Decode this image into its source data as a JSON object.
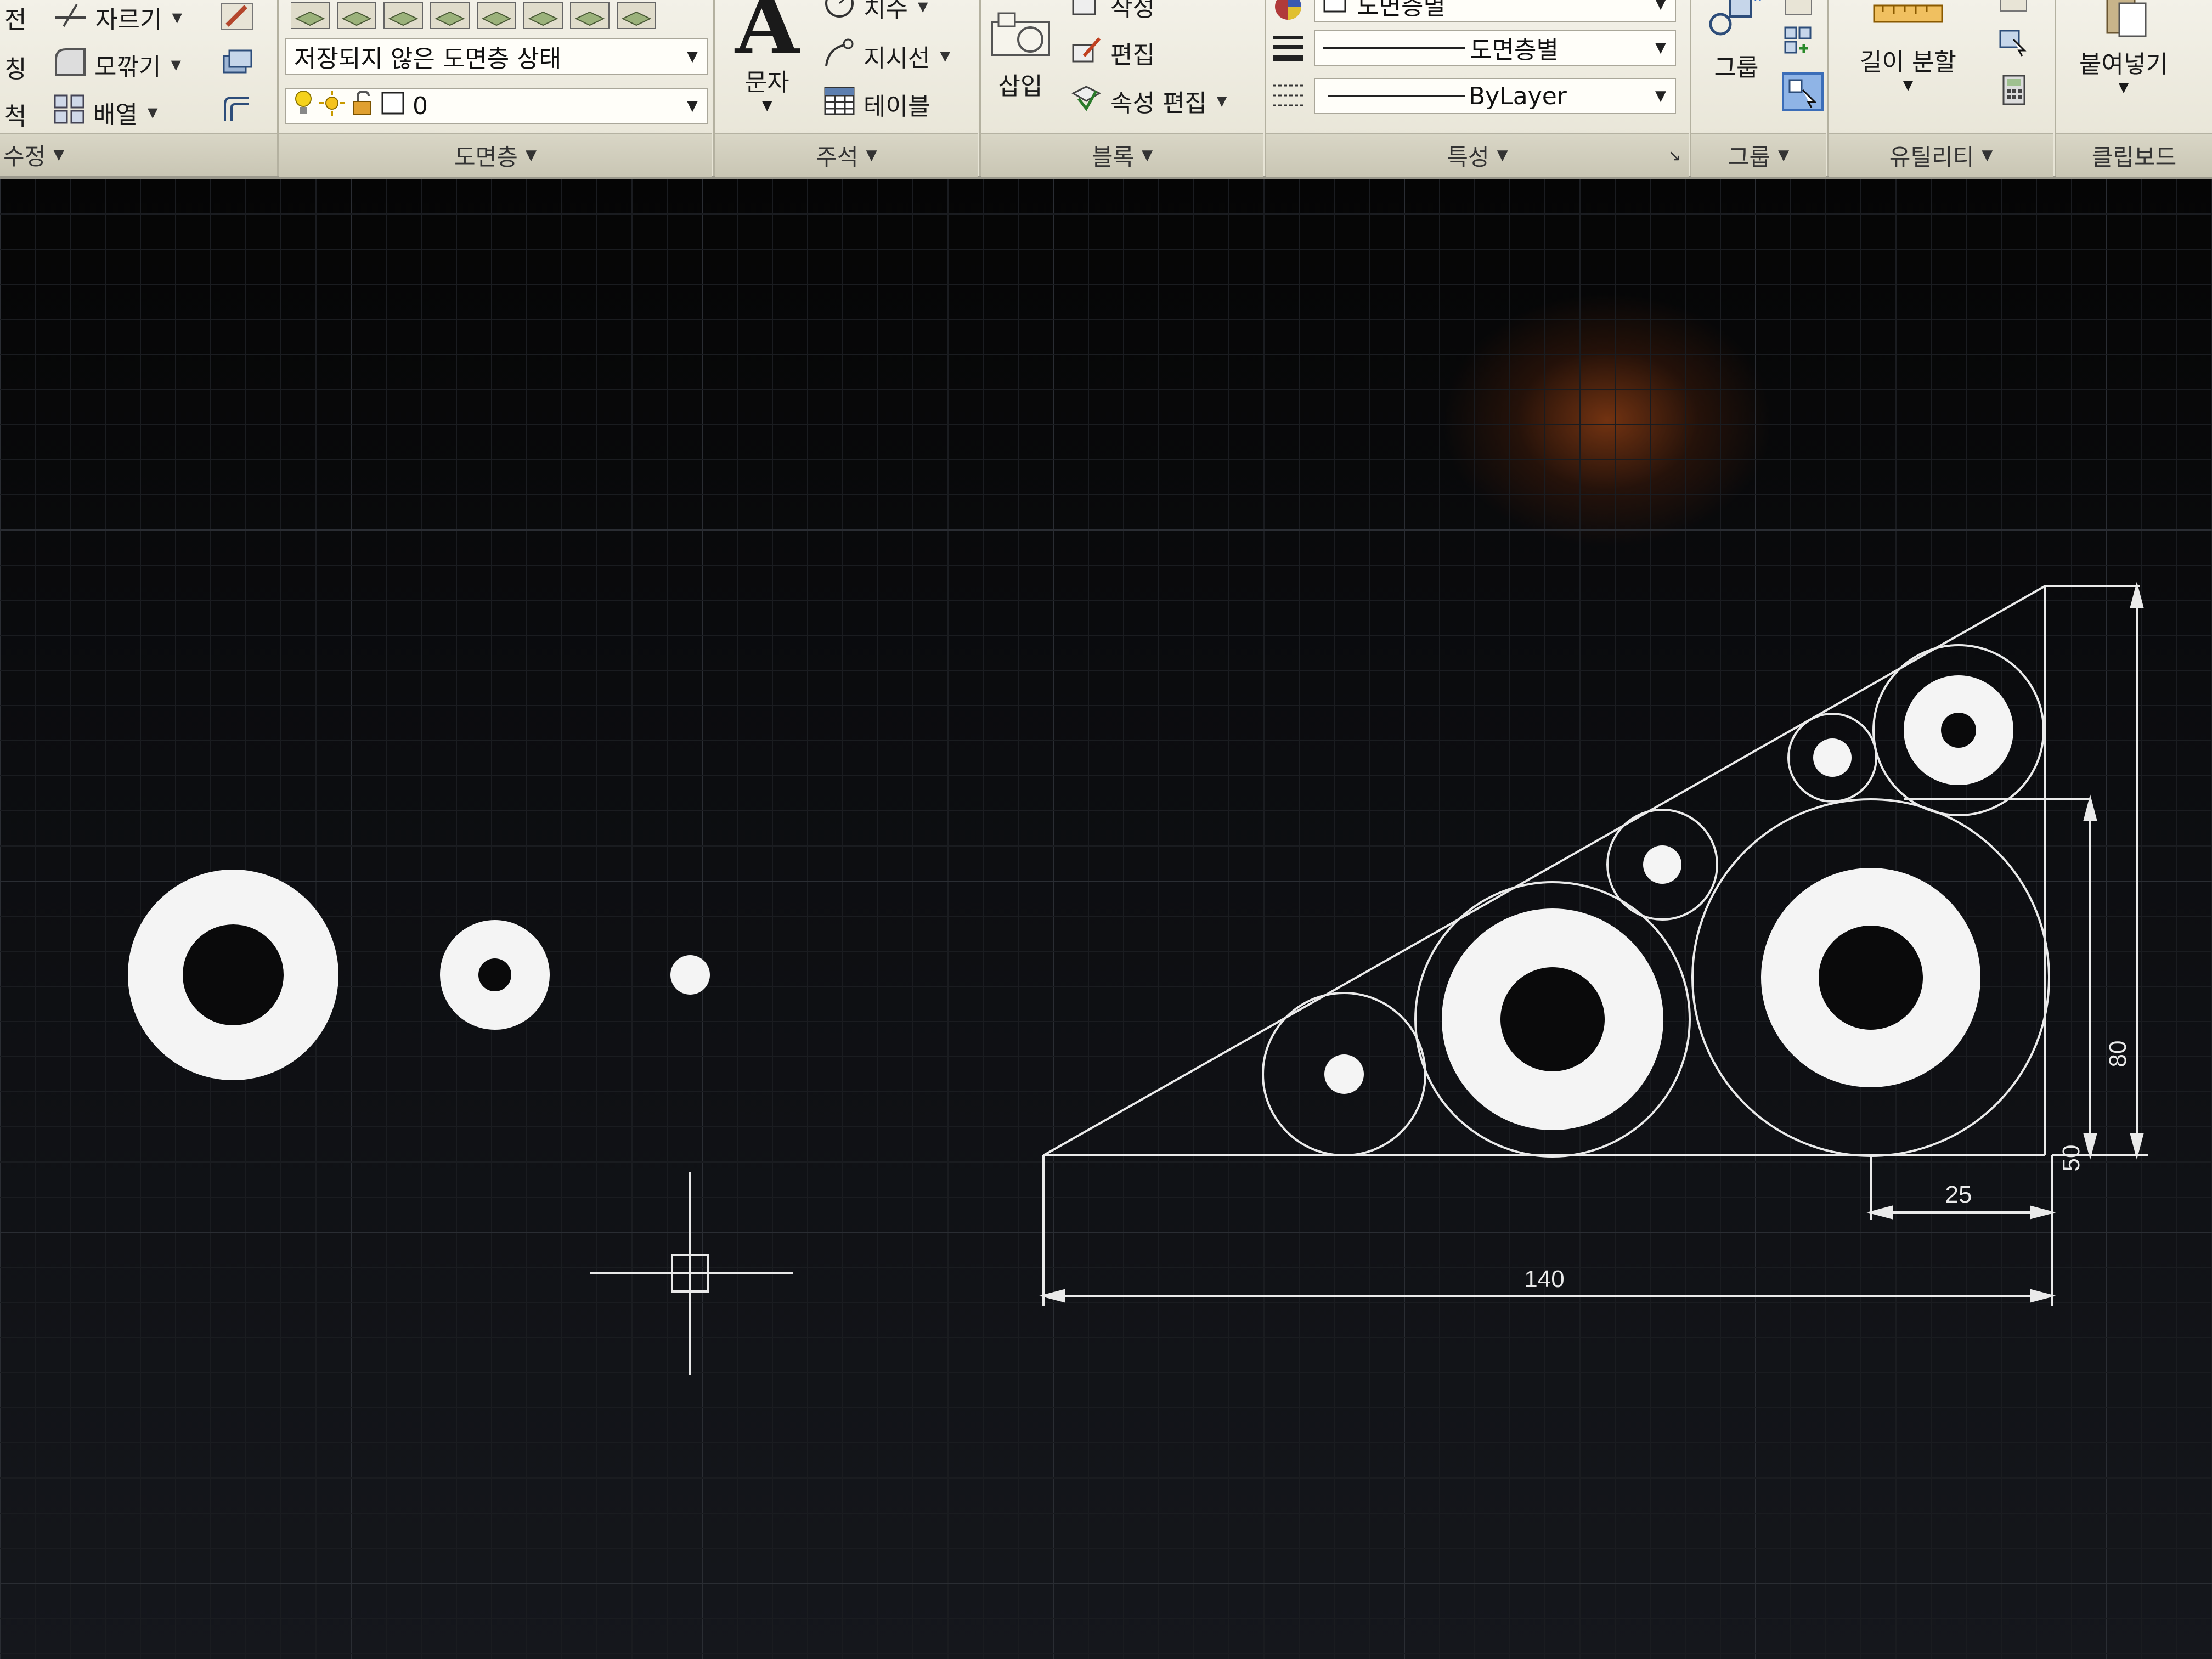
{
  "ribbon": {
    "modify": {
      "row1_label": "전",
      "row2_label": "칭",
      "row3_label": "척",
      "trim": "자르기",
      "fillet": "모깎기",
      "array": "배열",
      "panel_title": "수정"
    },
    "layers": {
      "layer_state": "저장되지 않은 도면층 상태",
      "current_layer": "0",
      "panel_title": "도면층"
    },
    "annotation": {
      "text": "문자",
      "dimension": "치수",
      "leader": "지시선",
      "table": "테이블",
      "panel_title": "주석"
    },
    "block": {
      "insert": "삽입",
      "create": "작성",
      "edit": "편집",
      "edit_attributes": "속성 편집",
      "panel_title": "블록"
    },
    "properties": {
      "color": "도면층별",
      "lineweight": "도면층별",
      "linetype": "ByLayer",
      "panel_title": "특성"
    },
    "groups": {
      "group": "그룹",
      "panel_title": "그룹"
    },
    "utilities": {
      "measure": "길이 분할",
      "panel_title": "유틸리티"
    },
    "clipboard": {
      "paste": "붙여넣기",
      "panel_title": "클립보드"
    }
  },
  "drawing": {
    "dimensions": {
      "base": "140",
      "offset": "25",
      "height_inner": "50",
      "height_total": "80"
    }
  }
}
